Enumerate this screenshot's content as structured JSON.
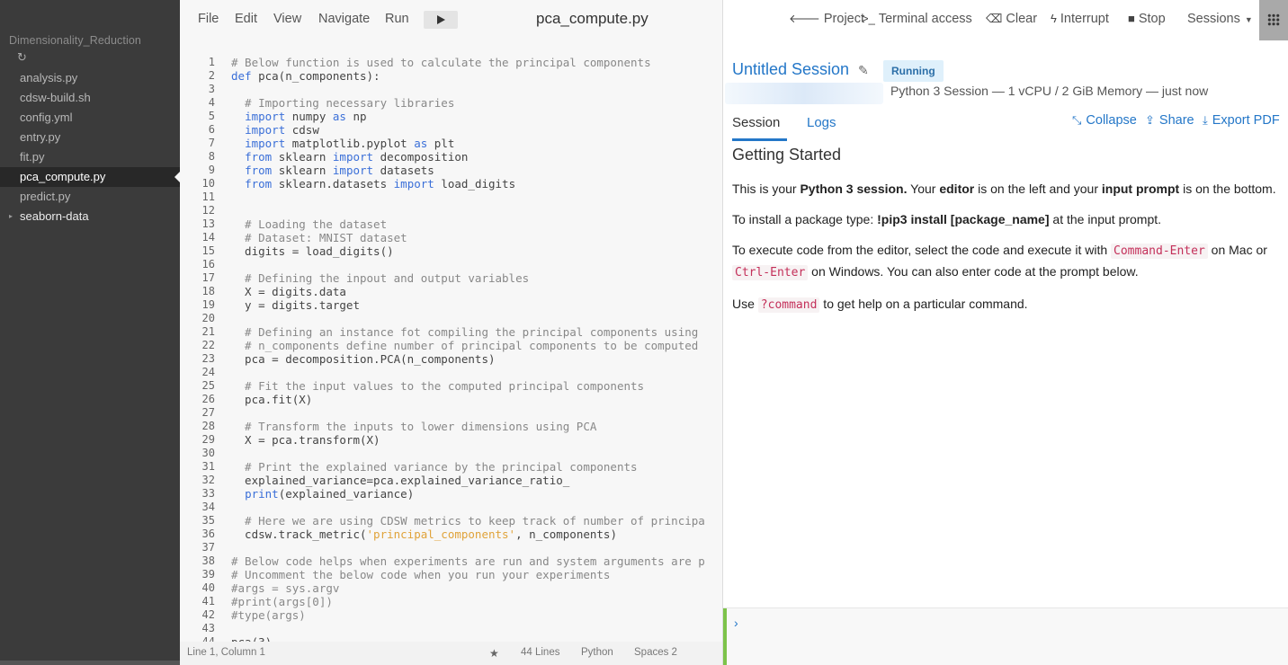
{
  "sidebar": {
    "project": "Dimensionality_Reduction",
    "refresh_icon": "↻",
    "files": [
      {
        "name": "analysis.py"
      },
      {
        "name": "cdsw-build.sh"
      },
      {
        "name": "config.yml"
      },
      {
        "name": "entry.py"
      },
      {
        "name": "fit.py"
      },
      {
        "name": "pca_compute.py",
        "active": true
      },
      {
        "name": "predict.py"
      },
      {
        "name": "seaborn-data",
        "folder": true
      }
    ]
  },
  "editor": {
    "menu": {
      "file": "File",
      "edit": "Edit",
      "view": "View",
      "navigate": "Navigate",
      "run": "Run"
    },
    "filename": "pca_compute.py",
    "lines": [
      [
        [
          "c",
          "# Below function is used to calculate the principal components"
        ]
      ],
      [
        [
          "k",
          "def"
        ],
        [
          "",
          " pca(n_components):"
        ]
      ],
      [],
      [
        [
          "c",
          "  # Importing necessary libraries"
        ]
      ],
      [
        [
          "",
          "  "
        ],
        [
          "k",
          "import"
        ],
        [
          "",
          " numpy "
        ],
        [
          "k",
          "as"
        ],
        [
          "",
          " np"
        ]
      ],
      [
        [
          "",
          "  "
        ],
        [
          "k",
          "import"
        ],
        [
          "",
          " cdsw"
        ]
      ],
      [
        [
          "",
          "  "
        ],
        [
          "k",
          "import"
        ],
        [
          "",
          " matplotlib.pyplot "
        ],
        [
          "k",
          "as"
        ],
        [
          "",
          " plt"
        ]
      ],
      [
        [
          "",
          "  "
        ],
        [
          "k",
          "from"
        ],
        [
          "",
          " sklearn "
        ],
        [
          "k",
          "import"
        ],
        [
          "",
          " decomposition"
        ]
      ],
      [
        [
          "",
          "  "
        ],
        [
          "k",
          "from"
        ],
        [
          "",
          " sklearn "
        ],
        [
          "k",
          "import"
        ],
        [
          "",
          " datasets"
        ]
      ],
      [
        [
          "",
          "  "
        ],
        [
          "k",
          "from"
        ],
        [
          "",
          " sklearn.datasets "
        ],
        [
          "k",
          "import"
        ],
        [
          "",
          " load_digits"
        ]
      ],
      [],
      [],
      [
        [
          "c",
          "  # Loading the dataset"
        ]
      ],
      [
        [
          "c",
          "  # Dataset: MNIST dataset"
        ]
      ],
      [
        [
          "",
          "  digits = load_digits()"
        ]
      ],
      [],
      [
        [
          "c",
          "  # Defining the inpout and output variables"
        ]
      ],
      [
        [
          "",
          "  X = digits.data"
        ]
      ],
      [
        [
          "",
          "  y = digits.target"
        ]
      ],
      [],
      [
        [
          "c",
          "  # Defining an instance fot compiling the principal components using"
        ]
      ],
      [
        [
          "c",
          "  # n_components define number of principal components to be computed"
        ]
      ],
      [
        [
          "",
          "  pca = decomposition.PCA(n_components)"
        ]
      ],
      [],
      [
        [
          "c",
          "  # Fit the input values to the computed principal components"
        ]
      ],
      [
        [
          "",
          "  pca.fit(X)"
        ]
      ],
      [],
      [
        [
          "c",
          "  # Transform the inputs to lower dimensions using PCA"
        ]
      ],
      [
        [
          "",
          "  X = pca.transform(X)"
        ]
      ],
      [],
      [
        [
          "c",
          "  # Print the explained variance by the principal components"
        ]
      ],
      [
        [
          "",
          "  explained_variance=pca.explained_variance_ratio_"
        ]
      ],
      [
        [
          "",
          "  "
        ],
        [
          "k",
          "print"
        ],
        [
          "",
          "(explained_variance)"
        ]
      ],
      [],
      [
        [
          "c",
          "  # Here we are using CDSW metrics to keep track of number of principa"
        ]
      ],
      [
        [
          "",
          "  cdsw.track_metric("
        ],
        [
          "s",
          "'principal_components'"
        ],
        [
          "",
          ", n_components)"
        ]
      ],
      [],
      [
        [
          "c",
          "# Below code helps when experiments are run and system arguments are p"
        ]
      ],
      [
        [
          "c",
          "# Uncomment the below code when you run your experiments"
        ]
      ],
      [
        [
          "c",
          "#args = sys.argv"
        ]
      ],
      [
        [
          "c",
          "#print(args[0])"
        ]
      ],
      [
        [
          "c",
          "#type(args)"
        ]
      ],
      [],
      [
        [
          "",
          "pca(3)"
        ]
      ]
    ],
    "status": {
      "position": "Line 1, Column 1",
      "star": "★",
      "lines": "44 Lines",
      "language": "Python",
      "spaces": "Spaces 2"
    }
  },
  "session": {
    "toolbar": {
      "project": "Project",
      "terminal": "Terminal access",
      "clear": "Clear",
      "interrupt": "Interrupt",
      "stop": "Stop",
      "sessions": "Sessions"
    },
    "title": "Untitled Session",
    "status": "Running",
    "meta": "Python 3 Session — 1 vCPU / 2 GiB Memory — just now",
    "tabs": {
      "session": "Session",
      "logs": "Logs"
    },
    "actions": {
      "collapse": "Collapse",
      "share": "Share",
      "export": "Export PDF"
    },
    "heading": "Getting Started",
    "p1": {
      "a": "This is your ",
      "b": "Python 3 session.",
      "c": " Your ",
      "d": "editor",
      "e": " is on the left and your ",
      "f": "input prompt",
      "g": " is on the bottom."
    },
    "p2": {
      "a": "To install a package type: ",
      "b": "!pip3 install [package_name]",
      "c": " at the input prompt."
    },
    "p3": {
      "a": "To execute code from the editor, select the code and execute it with ",
      "k1": "Command-Enter",
      "b": " on Mac or ",
      "k2": "Ctrl-Enter",
      "c": " on Windows. You can also enter code at the prompt below."
    },
    "p4": {
      "a": "Use ",
      "k": "?command",
      "b": " to get help on a particular command."
    },
    "prompt_symbol": "›"
  }
}
